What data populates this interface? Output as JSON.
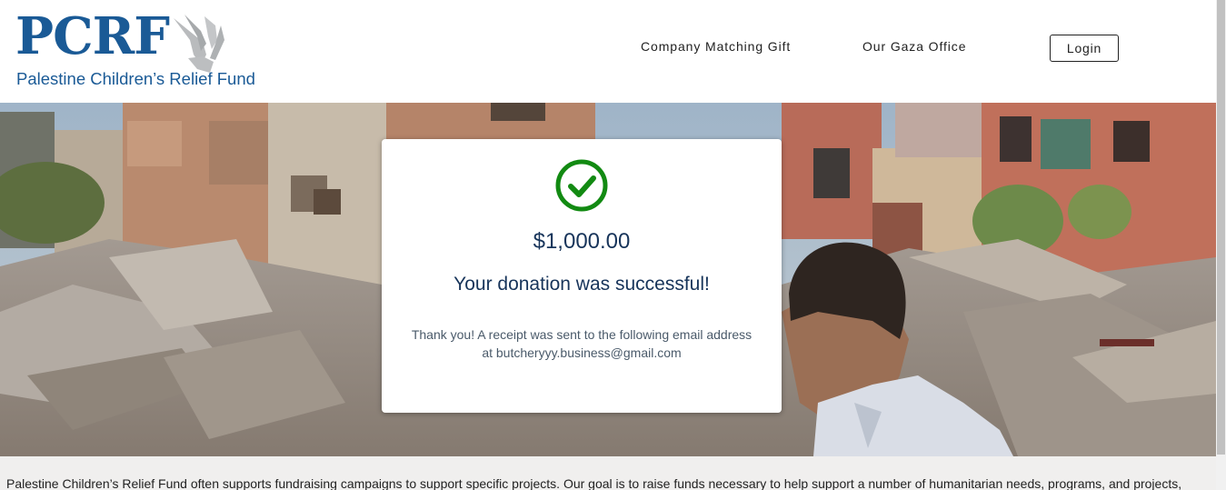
{
  "brand": {
    "logo_text": "PCRF",
    "logo_subtitle": "Palestine Children’s Relief Fund",
    "colors": {
      "primary": "#1a5a96",
      "success": "#128a12",
      "navy": "#17345a"
    }
  },
  "nav": {
    "links": [
      "Company Matching Gift",
      "Our Gaza Office"
    ],
    "login_label": "Login"
  },
  "hero": {
    "image": "rubble-street-boy-photo"
  },
  "donation": {
    "icon": "check-circle-icon",
    "amount": "$1,000.00",
    "status": "Your donation was successful!",
    "receipt_line1": "Thank you! A receipt was sent to the following email address",
    "receipt_line2": "at butcheryyy.business@gmail.com"
  },
  "footer": {
    "text": "Palestine Children’s Relief Fund often supports fundraising campaigns to support specific projects. Our goal is to raise funds necessary to help support a number of humanitarian needs, programs, and projects,"
  }
}
